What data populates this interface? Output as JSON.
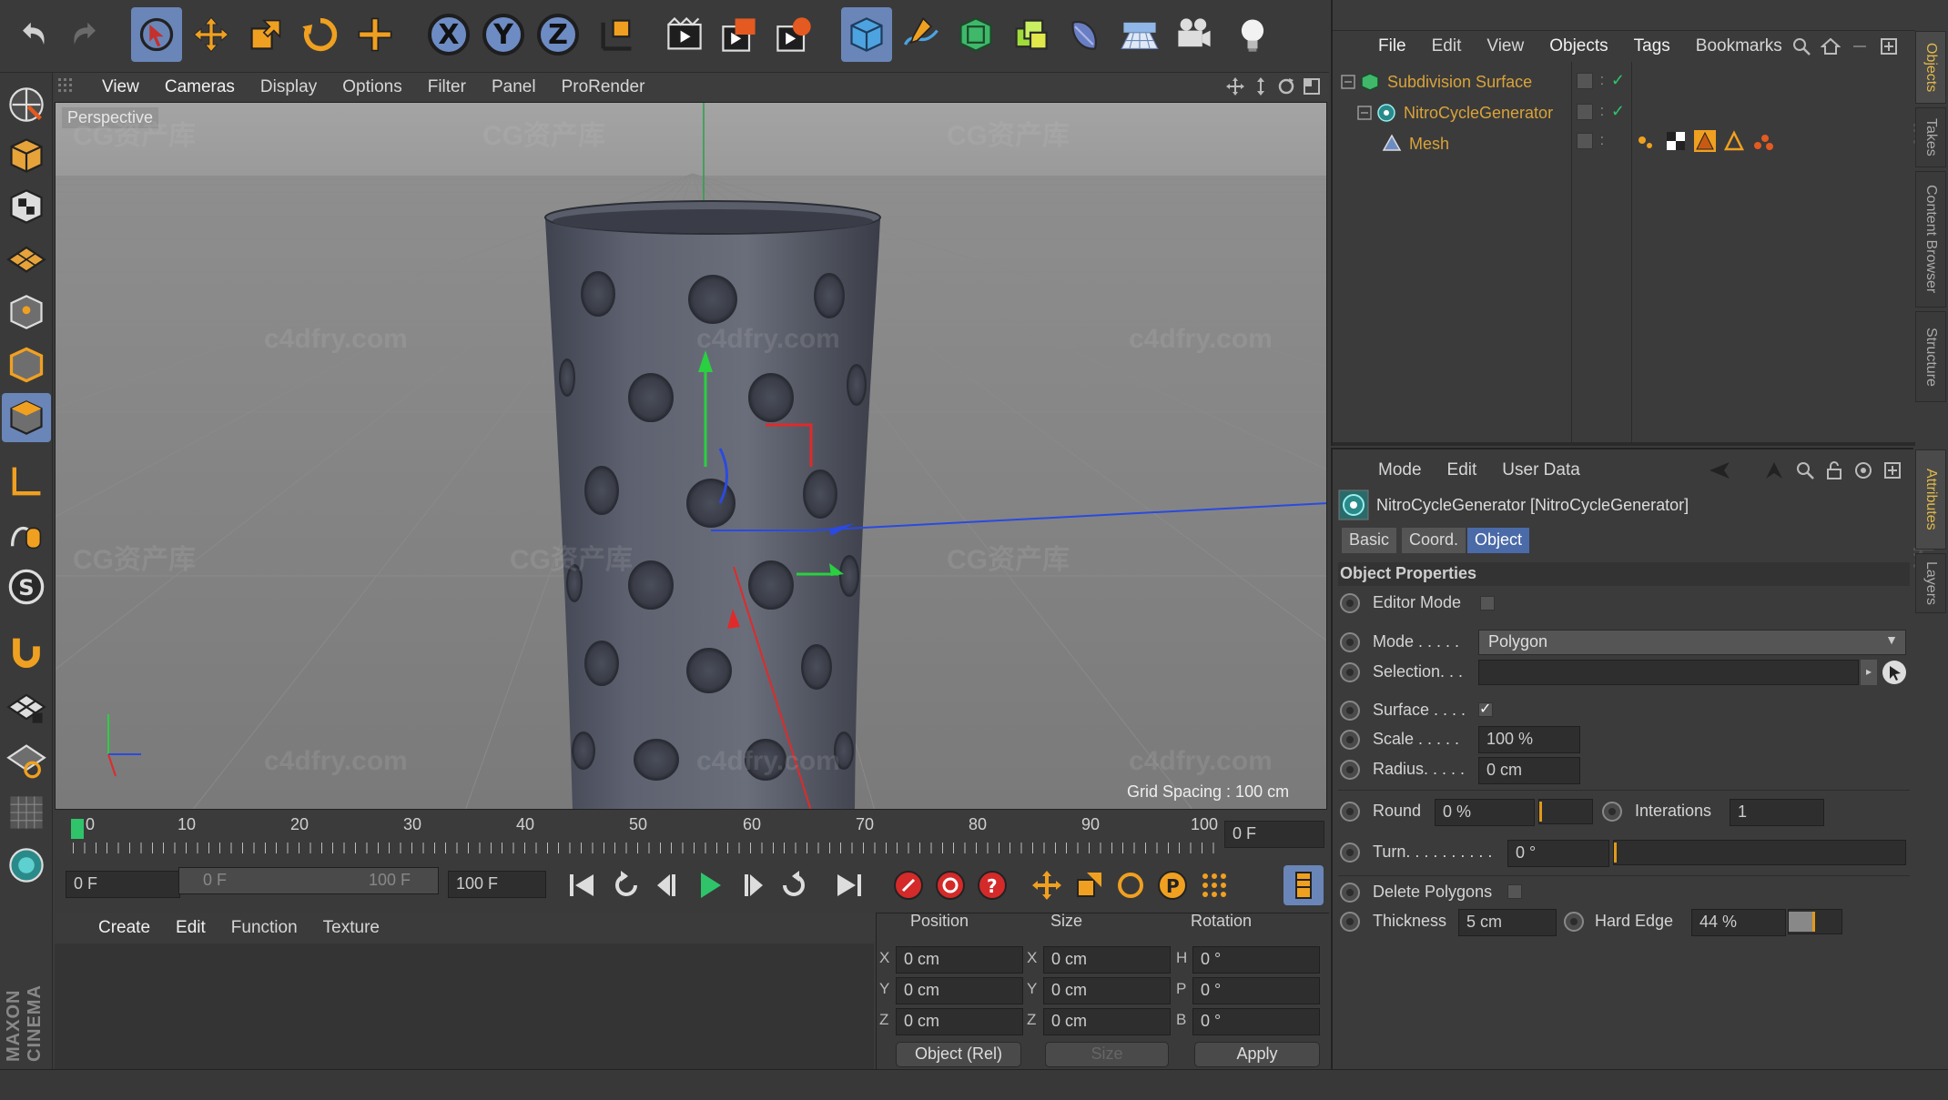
{
  "viewport": {
    "menu": [
      "View",
      "Cameras",
      "Display",
      "Options",
      "Filter",
      "Panel",
      "ProRender"
    ],
    "label": "Perspective",
    "grid_spacing": "Grid Spacing : 100 cm"
  },
  "toolbar": {
    "icons": [
      "undo-icon",
      "redo-icon",
      "select-tool-icon",
      "move-tool-icon",
      "scale-tool-icon",
      "rotate-tool-icon",
      "live-selection-icon",
      "x-axis-icon",
      "y-axis-icon",
      "z-axis-icon",
      "coordinate-system-icon",
      "render-view-icon",
      "render-picture-viewer-icon",
      "render-settings-icon",
      "cube-primitive-icon",
      "spline-pen-icon",
      "subdivision-surface-icon",
      "cloner-icon",
      "deformer-icon",
      "floor-icon",
      "camera-icon",
      "light-icon"
    ],
    "axis_labels": [
      "X",
      "Y",
      "Z"
    ]
  },
  "timeline": {
    "ticks": [
      "0",
      "10",
      "20",
      "30",
      "40",
      "50",
      "60",
      "70",
      "80",
      "90",
      "100"
    ],
    "current_frame": "0 F"
  },
  "transport": {
    "start_frame": "0 F",
    "range_start": "0 F",
    "range_end": "100 F",
    "end_frame": "100 F"
  },
  "materials": {
    "menu": [
      "Create",
      "Edit",
      "Function",
      "Texture"
    ]
  },
  "coordinates": {
    "headers": [
      "Position",
      "Size",
      "Rotation"
    ],
    "rows": [
      {
        "axis": "X",
        "pos": "0 cm",
        "size_axis": "X",
        "size": "0 cm",
        "rot_axis": "H",
        "rot": "0 °"
      },
      {
        "axis": "Y",
        "pos": "0 cm",
        "size_axis": "Y",
        "size": "0 cm",
        "rot_axis": "P",
        "rot": "0 °"
      },
      {
        "axis": "Z",
        "pos": "0 cm",
        "size_axis": "Z",
        "size": "0 cm",
        "rot_axis": "B",
        "rot": "0 °"
      }
    ],
    "mode_select": "Object (Rel)",
    "size_select": "Size",
    "apply_label": "Apply"
  },
  "objects": {
    "menu": [
      "File",
      "Edit",
      "View",
      "Objects",
      "Tags",
      "Bookmarks"
    ],
    "tree": [
      {
        "name": "Subdivision Surface",
        "color": "#d9a33a"
      },
      {
        "name": "NitroCycleGenerator",
        "color": "#d9a33a"
      },
      {
        "name": "Mesh",
        "color": "#d9a33a"
      }
    ]
  },
  "attributes": {
    "menu": [
      "Mode",
      "Edit",
      "User Data"
    ],
    "title": "NitroCycleGenerator [NitroCycleGenerator]",
    "tabs": [
      "Basic",
      "Coord.",
      "Object"
    ],
    "section": "Object Properties",
    "editor_mode_label": "Editor Mode",
    "mode_label": "Mode . . . . .",
    "mode_value": "Polygon",
    "selection_label": "Selection. . .",
    "surface_label": "Surface . . . .",
    "scale_label": "Scale . . . . .",
    "scale_value": "100 %",
    "radius_label": "Radius. . . . .",
    "radius_value": "0 cm",
    "round_label": "Round",
    "round_value": "0 %",
    "iterations_label": "Interations",
    "iterations_value": "1",
    "turn_label": "Turn. . . . . . . . . .",
    "turn_value": "0 °",
    "delete_polygons_label": "Delete Polygons",
    "thickness_label": "Thickness",
    "thickness_value": "5 cm",
    "hard_edge_label": "Hard Edge",
    "hard_edge_value": "44 %"
  },
  "side_tabs": [
    "Objects",
    "Takes",
    "Content Browser",
    "Structure",
    "Attributes",
    "Layers"
  ],
  "logo_text": "MAXON CINEMA",
  "watermarks": [
    "CG资产库",
    "c4dfry.com"
  ],
  "colors": {
    "accent": "#6a86b8",
    "tab_active": "#4b6aa8",
    "orange": "#e09a1a"
  }
}
